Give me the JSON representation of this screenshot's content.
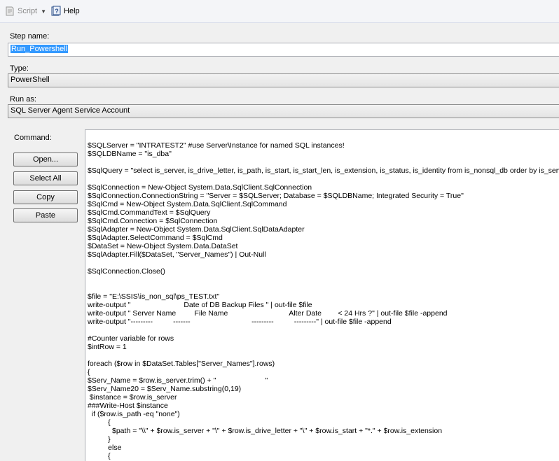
{
  "toolbar": {
    "script_label": "Script",
    "help_label": "Help"
  },
  "step_name": {
    "label": "Step name:",
    "value": "Run_Powershell"
  },
  "type": {
    "label": "Type:",
    "value": "PowerShell"
  },
  "run_as": {
    "label": "Run as:",
    "value": "SQL Server Agent Service Account"
  },
  "command": {
    "label": "Command:",
    "buttons": {
      "open": "Open...",
      "select_all": "Select All",
      "copy": "Copy",
      "paste": "Paste"
    },
    "lines": [
      "$SQLServer = \"INTRATEST2\" #use Server\\Instance for named SQL instances!",
      "$SQLDBName = \"is_dba\"",
      "",
      "$SqlQuery = \"select is_server, is_drive_letter, is_path, is_start, is_start_len, is_extension, is_status, is_identity from is_nonsql_db order by is_server\"",
      "",
      "$SqlConnection = New-Object System.Data.SqlClient.SqlConnection",
      "$SqlConnection.ConnectionString = \"Server = $SQLServer; Database = $SQLDBName; Integrated Security = True\"",
      "$SqlCmd = New-Object System.Data.SqlClient.SqlCommand",
      "$SqlCmd.CommandText = $SqlQuery",
      "$SqlCmd.Connection = $SqlConnection",
      "$SqlAdapter = New-Object System.Data.SqlClient.SqlDataAdapter",
      "$SqlAdapter.SelectCommand = $SqlCmd",
      "$DataSet = New-Object System.Data.DataSet",
      "$SqlAdapter.Fill($DataSet, \"Server_Names\") | Out-Null",
      "",
      "$SqlConnection.Close()",
      "",
      "",
      "$file = \"E:\\SSIS\\is_non_sql\\ps_TEST.txt\"",
      "write-output \"                          Date of DB Backup Files \" | out-file $file",
      "write-output \" Server Name         File Name                              Alter Date        < 24 Hrs ?\" | out-file $file -append",
      "write-output \"---------          -------                              ---------          ---------\" | out-file $file -append",
      "",
      "#Counter variable for rows",
      "$intRow = 1",
      "",
      "foreach ($row in $DataSet.Tables[\"Server_Names\"].rows)",
      "{",
      "$Serv_Name = $row.is_server.trim() + \"                        \"",
      "$Serv_Name20 = $Serv_Name.substring(0,19)",
      " $instance = $row.is_server",
      "###Write-Host $instance",
      "  if ($row.is_path -eq \"none\")",
      "          {",
      "            $path = \"\\\\\" + $row.is_server + \"\\\" + $row.is_drive_letter + \"\\\" + $row.is_start + \"*.\" + $row.is_extension",
      "          }",
      "          else",
      "          {"
    ]
  }
}
